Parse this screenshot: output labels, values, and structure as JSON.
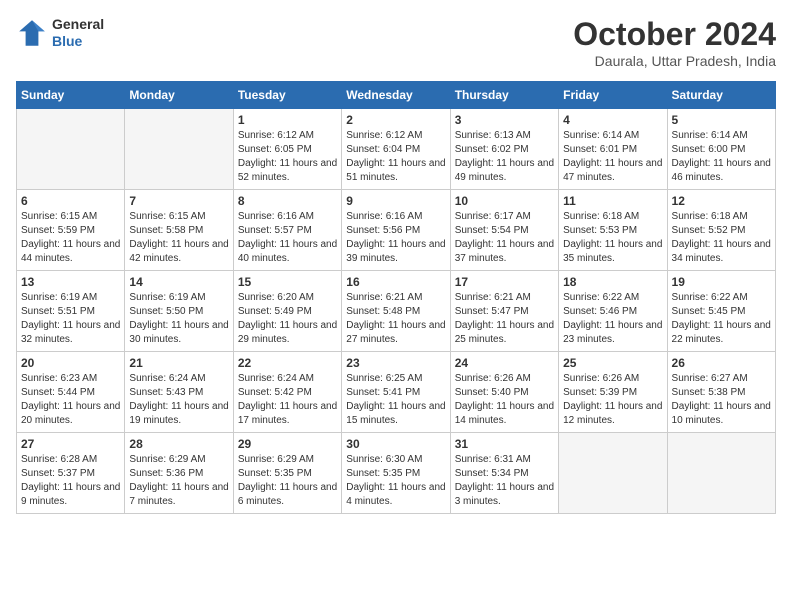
{
  "header": {
    "logo_general": "General",
    "logo_blue": "Blue",
    "month_year": "October 2024",
    "location": "Daurala, Uttar Pradesh, India"
  },
  "weekdays": [
    "Sunday",
    "Monday",
    "Tuesday",
    "Wednesday",
    "Thursday",
    "Friday",
    "Saturday"
  ],
  "weeks": [
    [
      {
        "day": "",
        "sunrise": "",
        "sunset": "",
        "daylight": ""
      },
      {
        "day": "",
        "sunrise": "",
        "sunset": "",
        "daylight": ""
      },
      {
        "day": "1",
        "sunrise": "Sunrise: 6:12 AM",
        "sunset": "Sunset: 6:05 PM",
        "daylight": "Daylight: 11 hours and 52 minutes."
      },
      {
        "day": "2",
        "sunrise": "Sunrise: 6:12 AM",
        "sunset": "Sunset: 6:04 PM",
        "daylight": "Daylight: 11 hours and 51 minutes."
      },
      {
        "day": "3",
        "sunrise": "Sunrise: 6:13 AM",
        "sunset": "Sunset: 6:02 PM",
        "daylight": "Daylight: 11 hours and 49 minutes."
      },
      {
        "day": "4",
        "sunrise": "Sunrise: 6:14 AM",
        "sunset": "Sunset: 6:01 PM",
        "daylight": "Daylight: 11 hours and 47 minutes."
      },
      {
        "day": "5",
        "sunrise": "Sunrise: 6:14 AM",
        "sunset": "Sunset: 6:00 PM",
        "daylight": "Daylight: 11 hours and 46 minutes."
      }
    ],
    [
      {
        "day": "6",
        "sunrise": "Sunrise: 6:15 AM",
        "sunset": "Sunset: 5:59 PM",
        "daylight": "Daylight: 11 hours and 44 minutes."
      },
      {
        "day": "7",
        "sunrise": "Sunrise: 6:15 AM",
        "sunset": "Sunset: 5:58 PM",
        "daylight": "Daylight: 11 hours and 42 minutes."
      },
      {
        "day": "8",
        "sunrise": "Sunrise: 6:16 AM",
        "sunset": "Sunset: 5:57 PM",
        "daylight": "Daylight: 11 hours and 40 minutes."
      },
      {
        "day": "9",
        "sunrise": "Sunrise: 6:16 AM",
        "sunset": "Sunset: 5:56 PM",
        "daylight": "Daylight: 11 hours and 39 minutes."
      },
      {
        "day": "10",
        "sunrise": "Sunrise: 6:17 AM",
        "sunset": "Sunset: 5:54 PM",
        "daylight": "Daylight: 11 hours and 37 minutes."
      },
      {
        "day": "11",
        "sunrise": "Sunrise: 6:18 AM",
        "sunset": "Sunset: 5:53 PM",
        "daylight": "Daylight: 11 hours and 35 minutes."
      },
      {
        "day": "12",
        "sunrise": "Sunrise: 6:18 AM",
        "sunset": "Sunset: 5:52 PM",
        "daylight": "Daylight: 11 hours and 34 minutes."
      }
    ],
    [
      {
        "day": "13",
        "sunrise": "Sunrise: 6:19 AM",
        "sunset": "Sunset: 5:51 PM",
        "daylight": "Daylight: 11 hours and 32 minutes."
      },
      {
        "day": "14",
        "sunrise": "Sunrise: 6:19 AM",
        "sunset": "Sunset: 5:50 PM",
        "daylight": "Daylight: 11 hours and 30 minutes."
      },
      {
        "day": "15",
        "sunrise": "Sunrise: 6:20 AM",
        "sunset": "Sunset: 5:49 PM",
        "daylight": "Daylight: 11 hours and 29 minutes."
      },
      {
        "day": "16",
        "sunrise": "Sunrise: 6:21 AM",
        "sunset": "Sunset: 5:48 PM",
        "daylight": "Daylight: 11 hours and 27 minutes."
      },
      {
        "day": "17",
        "sunrise": "Sunrise: 6:21 AM",
        "sunset": "Sunset: 5:47 PM",
        "daylight": "Daylight: 11 hours and 25 minutes."
      },
      {
        "day": "18",
        "sunrise": "Sunrise: 6:22 AM",
        "sunset": "Sunset: 5:46 PM",
        "daylight": "Daylight: 11 hours and 23 minutes."
      },
      {
        "day": "19",
        "sunrise": "Sunrise: 6:22 AM",
        "sunset": "Sunset: 5:45 PM",
        "daylight": "Daylight: 11 hours and 22 minutes."
      }
    ],
    [
      {
        "day": "20",
        "sunrise": "Sunrise: 6:23 AM",
        "sunset": "Sunset: 5:44 PM",
        "daylight": "Daylight: 11 hours and 20 minutes."
      },
      {
        "day": "21",
        "sunrise": "Sunrise: 6:24 AM",
        "sunset": "Sunset: 5:43 PM",
        "daylight": "Daylight: 11 hours and 19 minutes."
      },
      {
        "day": "22",
        "sunrise": "Sunrise: 6:24 AM",
        "sunset": "Sunset: 5:42 PM",
        "daylight": "Daylight: 11 hours and 17 minutes."
      },
      {
        "day": "23",
        "sunrise": "Sunrise: 6:25 AM",
        "sunset": "Sunset: 5:41 PM",
        "daylight": "Daylight: 11 hours and 15 minutes."
      },
      {
        "day": "24",
        "sunrise": "Sunrise: 6:26 AM",
        "sunset": "Sunset: 5:40 PM",
        "daylight": "Daylight: 11 hours and 14 minutes."
      },
      {
        "day": "25",
        "sunrise": "Sunrise: 6:26 AM",
        "sunset": "Sunset: 5:39 PM",
        "daylight": "Daylight: 11 hours and 12 minutes."
      },
      {
        "day": "26",
        "sunrise": "Sunrise: 6:27 AM",
        "sunset": "Sunset: 5:38 PM",
        "daylight": "Daylight: 11 hours and 10 minutes."
      }
    ],
    [
      {
        "day": "27",
        "sunrise": "Sunrise: 6:28 AM",
        "sunset": "Sunset: 5:37 PM",
        "daylight": "Daylight: 11 hours and 9 minutes."
      },
      {
        "day": "28",
        "sunrise": "Sunrise: 6:29 AM",
        "sunset": "Sunset: 5:36 PM",
        "daylight": "Daylight: 11 hours and 7 minutes."
      },
      {
        "day": "29",
        "sunrise": "Sunrise: 6:29 AM",
        "sunset": "Sunset: 5:35 PM",
        "daylight": "Daylight: 11 hours and 6 minutes."
      },
      {
        "day": "30",
        "sunrise": "Sunrise: 6:30 AM",
        "sunset": "Sunset: 5:35 PM",
        "daylight": "Daylight: 11 hours and 4 minutes."
      },
      {
        "day": "31",
        "sunrise": "Sunrise: 6:31 AM",
        "sunset": "Sunset: 5:34 PM",
        "daylight": "Daylight: 11 hours and 3 minutes."
      },
      {
        "day": "",
        "sunrise": "",
        "sunset": "",
        "daylight": ""
      },
      {
        "day": "",
        "sunrise": "",
        "sunset": "",
        "daylight": ""
      }
    ]
  ]
}
